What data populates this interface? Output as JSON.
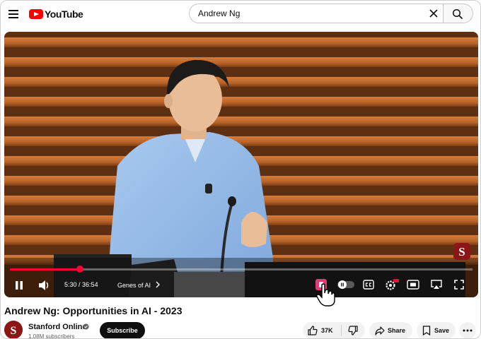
{
  "header": {
    "logo_text": "YouTube",
    "search": {
      "value": "Andrew Ng"
    }
  },
  "player": {
    "progress_fraction": 0.151,
    "current_time": "5:30",
    "total_time": "36:54",
    "time_separator": " / ",
    "chapter_label": "Genes of AI",
    "badge_text": "S",
    "brand_color": "#ff0033"
  },
  "video": {
    "title": "Andrew Ng: Opportunities in AI - 2023",
    "channel_name": "Stanford Online",
    "subscribers": "1.08M subscribers",
    "subscribe_label": "Subscribe",
    "likes": "37K",
    "share_label": "Share",
    "save_label": "Save"
  },
  "colors": {
    "accent": "#ff0000",
    "stanford": "#8c1515"
  }
}
